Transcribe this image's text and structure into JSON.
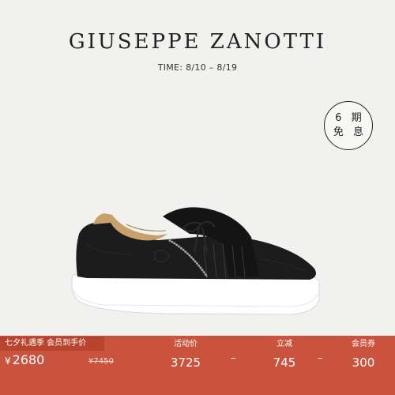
{
  "brand": "GIUSEPPE ZANOTTI",
  "time_label": "TIME: 8/10 – 8/19",
  "badge": {
    "line1": "6 期",
    "line2": "免 息"
  },
  "price_bar": {
    "promo_label": "七夕礼遇季 会员到手价",
    "currency": "¥",
    "final_price": "2680",
    "original_price": "¥7450",
    "columns": [
      {
        "label": "活动价",
        "value": "3725"
      },
      {
        "label": "立减",
        "value": "745"
      },
      {
        "label": "会员券",
        "value": "300"
      }
    ],
    "operator1": "–",
    "operator2": "–"
  },
  "colors": {
    "bar": "#c9533d",
    "background": "#f1f1ef"
  }
}
